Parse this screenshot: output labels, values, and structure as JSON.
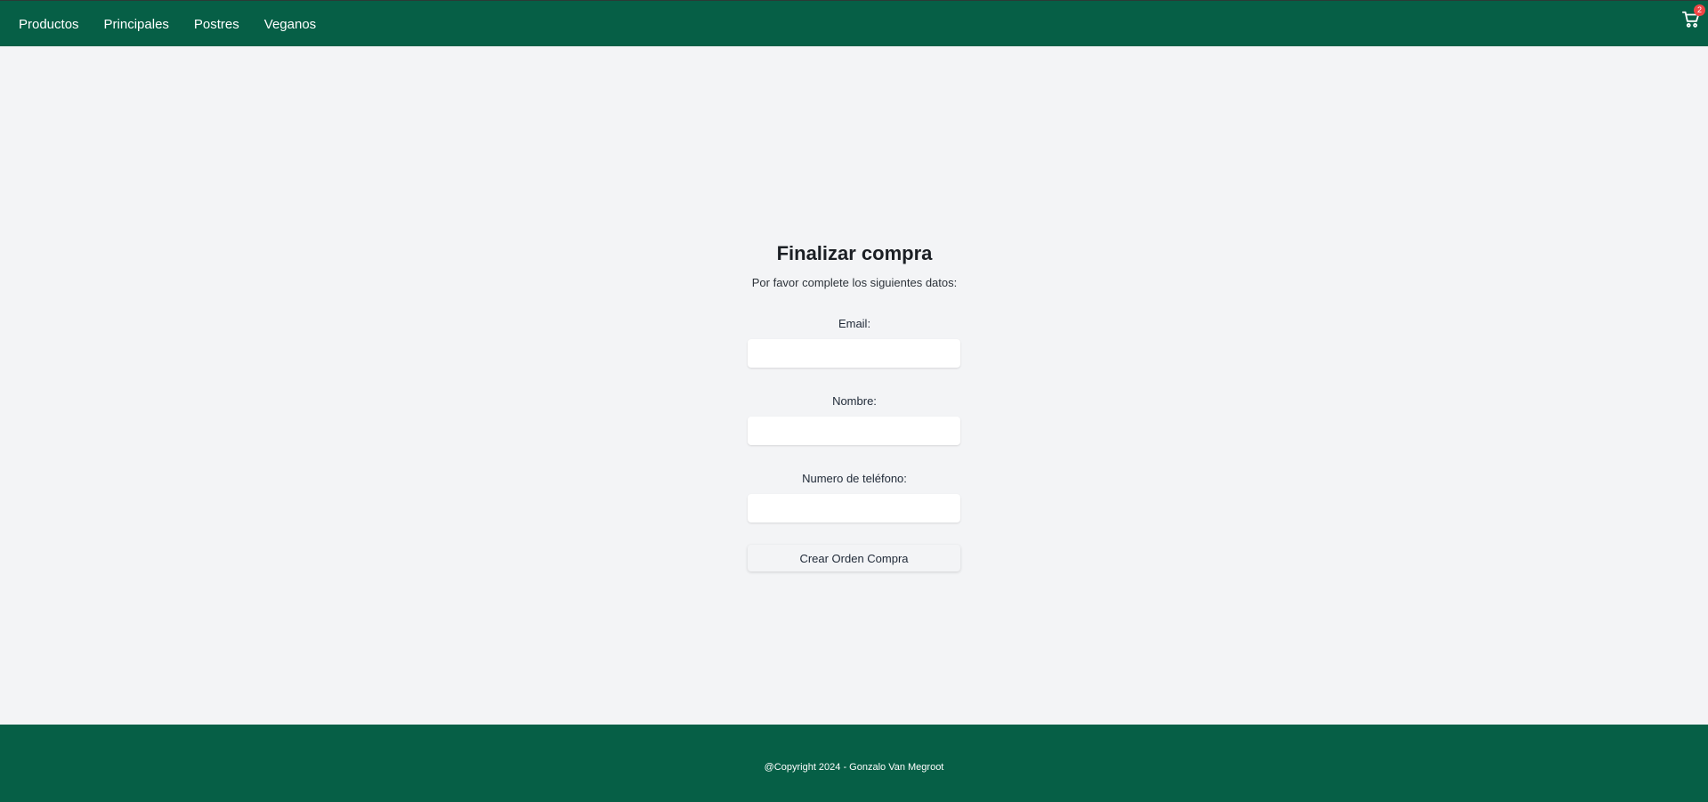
{
  "nav": {
    "items": [
      {
        "label": "Productos"
      },
      {
        "label": "Principales"
      },
      {
        "label": "Postres"
      },
      {
        "label": "Veganos"
      }
    ],
    "cart": {
      "icon": "cart-icon",
      "count": "2"
    }
  },
  "checkout": {
    "title": "Finalizar compra",
    "subtitle": "Por favor complete los siguientes datos:",
    "fields": {
      "email": {
        "label": "Email:",
        "value": "",
        "placeholder": ""
      },
      "name": {
        "label": "Nombre:",
        "value": "",
        "placeholder": ""
      },
      "phone": {
        "label": "Numero de teléfono:",
        "value": "",
        "placeholder": ""
      }
    },
    "submit_label": "Crear Orden Compra"
  },
  "footer": {
    "copyright": "@Copyright 2024 - Gonzalo Van Megroot"
  },
  "colors": {
    "brand": "#065f46",
    "background": "#f3f4f6",
    "badge": "#ef4444"
  }
}
